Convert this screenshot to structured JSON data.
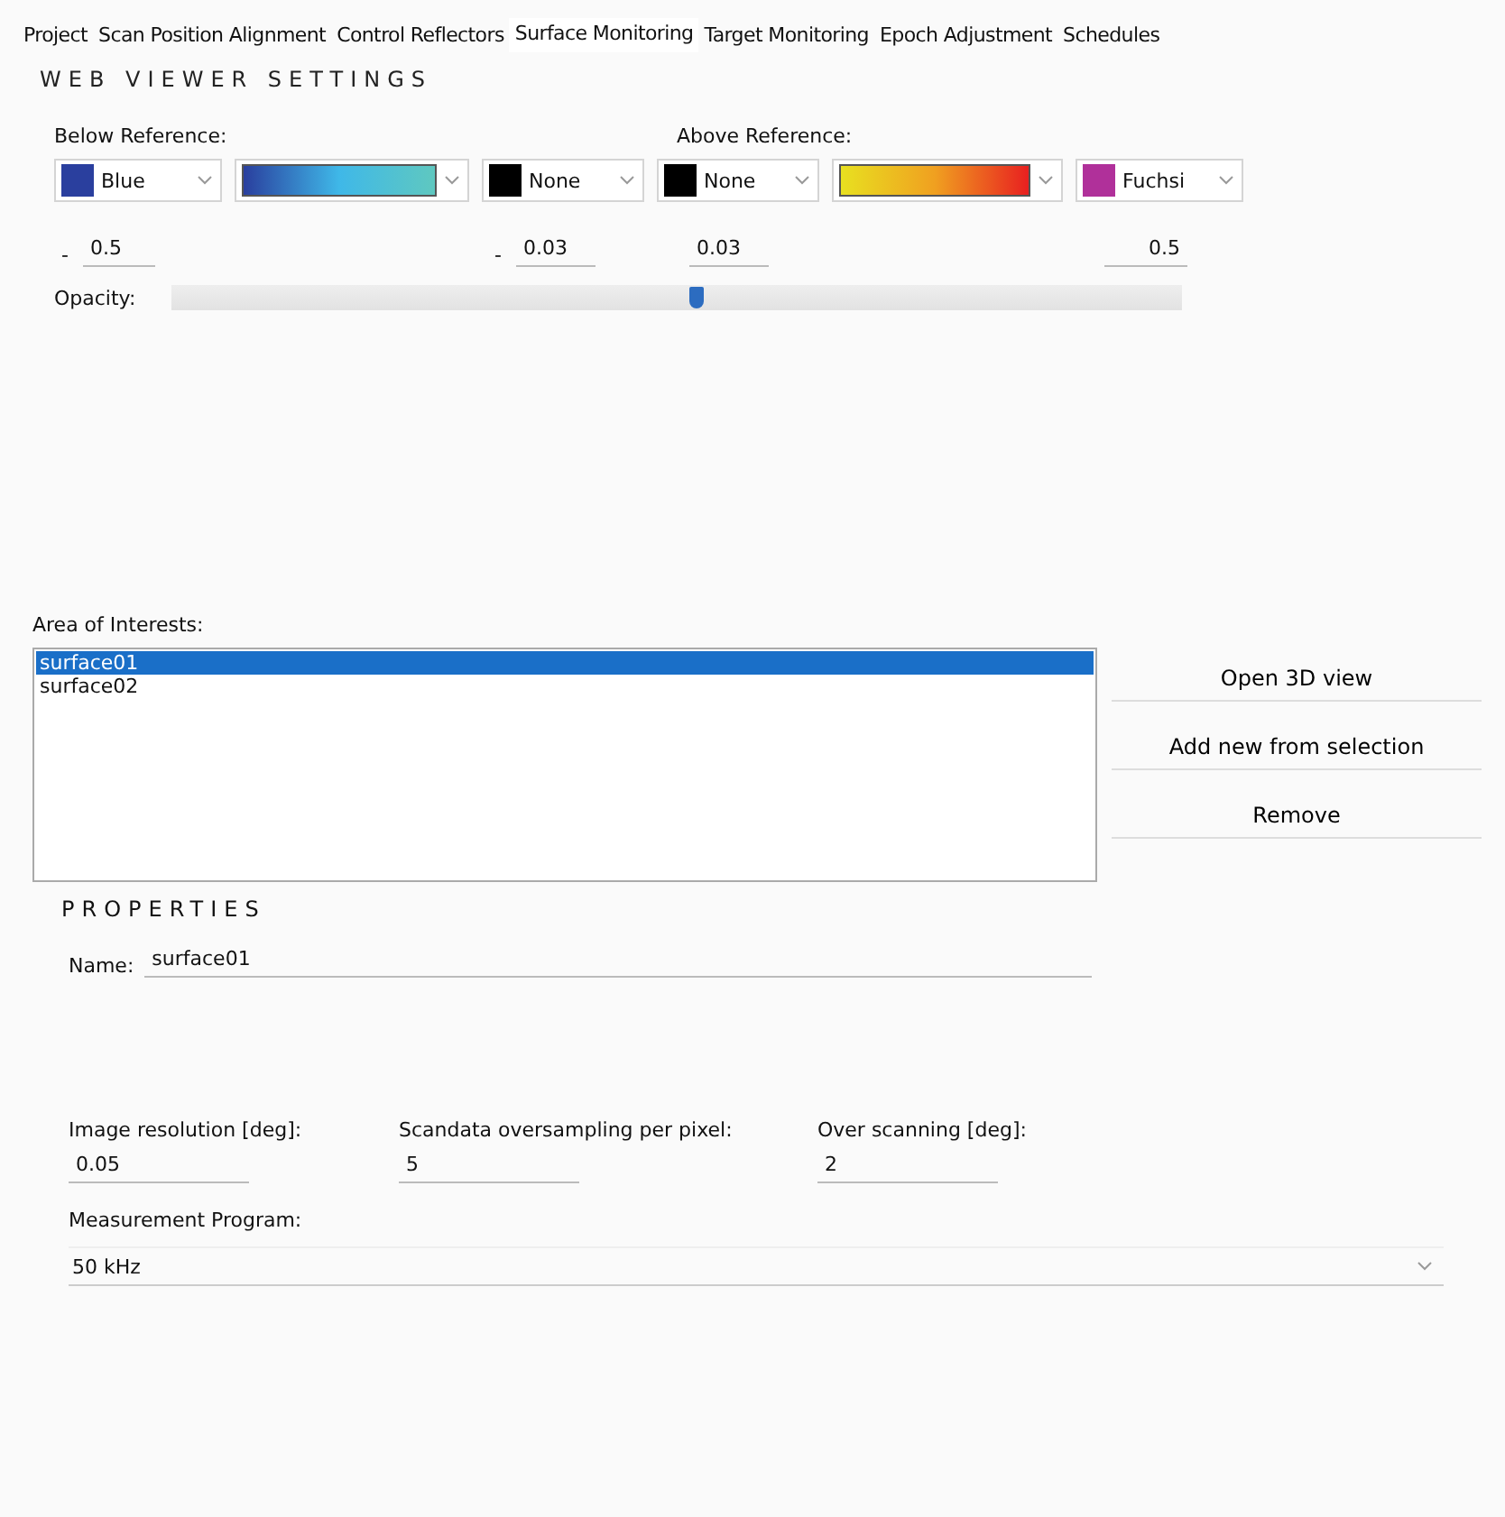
{
  "tabs": [
    {
      "label": "Project",
      "selected": false
    },
    {
      "label": "Scan Position Alignment",
      "selected": false
    },
    {
      "label": "Control Reflectors",
      "selected": false
    },
    {
      "label": "Surface Monitoring",
      "selected": true
    },
    {
      "label": "Target Monitoring",
      "selected": false
    },
    {
      "label": "Epoch Adjustment",
      "selected": false
    },
    {
      "label": "Schedules",
      "selected": false
    }
  ],
  "web_viewer_settings": {
    "title": "WEB VIEWER SETTINGS",
    "below_reference_label": "Below Reference:",
    "above_reference_label": "Above Reference:",
    "color_pickers": [
      {
        "kind": "swatch",
        "color": "#2a3f9e",
        "label": "Blue"
      },
      {
        "kind": "coolramp"
      },
      {
        "kind": "swatch",
        "color": "#000000",
        "label": "None"
      },
      {
        "kind": "swatch",
        "color": "#000000",
        "label": "None"
      },
      {
        "kind": "warmramp"
      },
      {
        "kind": "swatch",
        "color": "#b0309a",
        "label": "Fuchsi"
      }
    ],
    "thresholds": [
      {
        "sign": "-",
        "value": "0.5"
      },
      {
        "sign": "-",
        "value": "0.03"
      },
      {
        "value": "0.03"
      },
      {
        "value": "0.5"
      }
    ],
    "opacity_label": "Opacity:",
    "opacity": {
      "level": 0.52
    }
  },
  "area_of_interests": {
    "label": "Area of Interests:",
    "items": [
      {
        "label": "surface01",
        "selected": true
      },
      {
        "label": "surface02",
        "selected": false
      }
    ],
    "buttons": [
      "Open 3D view",
      "Add new from selection",
      "Remove"
    ]
  },
  "properties": {
    "title": "PROPERTIES",
    "name_label": "Name:",
    "name_value": "surface01",
    "fields": [
      {
        "label": "Image resolution [deg]:",
        "value": "0.05"
      },
      {
        "label": "Scandata oversampling per pixel:",
        "value": "5"
      },
      {
        "label": "Over scanning [deg]:",
        "value": "2"
      }
    ],
    "measurement_program_label": "Measurement Program:",
    "measurement_program": "50 kHz"
  }
}
